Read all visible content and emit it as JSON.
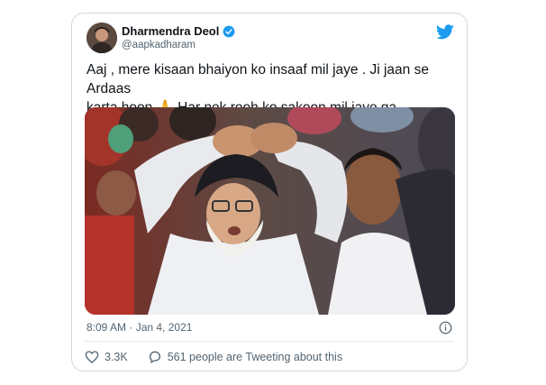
{
  "tweet": {
    "author_name": "Dharmendra Deol",
    "author_handle": "@aapkadharam",
    "text_line1": "Aaj , mere kisaan bhaiyon ko insaaf mil jaye . Ji jaan se Ardaas",
    "text_line2": "karta hoon 🙏 Har nek rooh ko sakoon mil jaye ga ......",
    "timestamp": "8:09 AM · Jan 4, 2021",
    "likes": "3.3K",
    "conversation": "561 people are Tweeting about this"
  },
  "icons": {
    "verified": "verified-badge-icon",
    "brand": "twitter-bird-icon",
    "info": "info-icon",
    "like": "heart-icon",
    "reply": "speech-bubble-icon"
  },
  "colors": {
    "twitter_blue": "#1d9bf0",
    "text_primary": "#0f1419",
    "text_secondary": "#536471",
    "border": "#cfd9de"
  }
}
